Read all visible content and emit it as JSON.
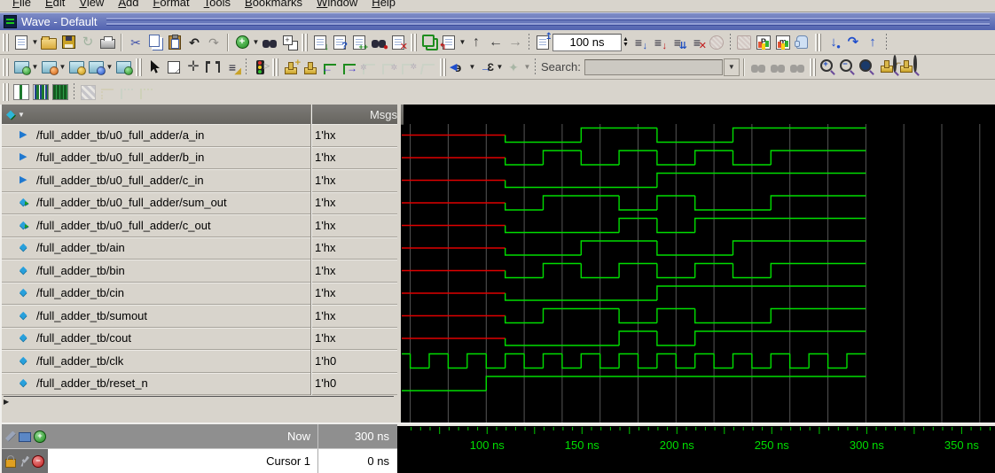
{
  "menu": {
    "items": [
      "File",
      "Edit",
      "View",
      "Add",
      "Format",
      "Tools",
      "Bookmarks",
      "Window",
      "Help"
    ]
  },
  "window": {
    "title": "Wave - Default"
  },
  "toolbar": {
    "time_value": "100 ns",
    "search_label": "Search:",
    "search_value": "",
    "row1_icons": [
      "new-doc",
      "new-doc-dropdown",
      "open-folder",
      "save",
      "refresh",
      "print",
      "cut",
      "copy",
      "paste",
      "undo",
      "redo",
      "add-circle",
      "add-dropdown",
      "find-binoculars",
      "expand-items",
      "comment-stack",
      "doc-help",
      "doc-add",
      "find-marked",
      "doc-delete",
      "link",
      "trace-list",
      "arrow-up",
      "arrow-back",
      "arrow-forward",
      "run-length-doc",
      "time-field",
      "time-spinner",
      "run",
      "run-continue",
      "run-all",
      "break-doc",
      "stop",
      "restart",
      "profile-p",
      "memory-m",
      "pause-hand",
      "step-into",
      "step-over",
      "step-out"
    ],
    "row2_icons": [
      "sim-chip-green",
      "sim-chip-orange",
      "sim-chip-gold",
      "sim-chip-save",
      "sim-chip-run",
      "select-pointer",
      "zoom-mode",
      "pan-mode",
      "cursor-pair",
      "edit-mode",
      "stop-sign-traffic",
      "stamp-add",
      "stamp",
      "edge-left",
      "edge-right",
      "wave-cut",
      "wave-copy",
      "wave-paste",
      "wave-insert",
      "prev-transition",
      "next-transition",
      "insert-marker",
      "search-input",
      "search-dropdown",
      "find-prev",
      "find-next",
      "find-all",
      "zoom-in",
      "zoom-out",
      "zoom-full",
      "zoom-cursor",
      "zoom-range"
    ],
    "row3_icons": [
      "wave-format-literal",
      "wave-format-logic",
      "wave-format-analog",
      "grid-pattern",
      "wave-pale-1",
      "wave-pale-2",
      "wave-pale-3"
    ]
  },
  "header": {
    "msgs_label": "Msgs"
  },
  "footer": {
    "now_label": "Now",
    "now_value": "300 ns",
    "cursor_label": "Cursor 1",
    "cursor_value": "0 ns"
  },
  "chart_data": {
    "type": "digital-waveform",
    "title": "ModelSim Wave - full adder testbench",
    "time_unit": "ns",
    "t_visible": [
      55.5,
      368.5
    ],
    "t_data_end": 300,
    "grid": {
      "start": 60,
      "step": 20,
      "color": "#565656"
    },
    "ruler": {
      "minor_step": 5,
      "label_step": 50,
      "labels": [
        100,
        150,
        200,
        250,
        300,
        350
      ]
    },
    "colors": {
      "signal": "#00dd00",
      "unknown": "#e00000",
      "background": "#000000"
    },
    "signals": [
      {
        "name": "/full_adder_tb/u0_full_adder/a_in",
        "value": "1'hx",
        "kind": "input",
        "wave": [
          [
            55.5,
            "x"
          ],
          [
            110,
            0
          ],
          [
            150,
            1
          ],
          [
            190,
            0
          ],
          [
            230,
            1
          ]
        ]
      },
      {
        "name": "/full_adder_tb/u0_full_adder/b_in",
        "value": "1'hx",
        "kind": "input",
        "wave": [
          [
            55.5,
            "x"
          ],
          [
            110,
            0
          ],
          [
            130,
            1
          ],
          [
            150,
            0
          ],
          [
            170,
            1
          ],
          [
            190,
            0
          ],
          [
            210,
            1
          ],
          [
            230,
            0
          ],
          [
            250,
            1
          ]
        ]
      },
      {
        "name": "/full_adder_tb/u0_full_adder/c_in",
        "value": "1'hx",
        "kind": "input",
        "wave": [
          [
            55.5,
            "x"
          ],
          [
            110,
            0
          ],
          [
            190,
            1
          ]
        ]
      },
      {
        "name": "/full_adder_tb/u0_full_adder/sum_out",
        "value": "1'hx",
        "kind": "output",
        "wave": [
          [
            55.5,
            "x"
          ],
          [
            110,
            0
          ],
          [
            130,
            1
          ],
          [
            170,
            0
          ],
          [
            190,
            1
          ],
          [
            210,
            0
          ],
          [
            250,
            1
          ]
        ]
      },
      {
        "name": "/full_adder_tb/u0_full_adder/c_out",
        "value": "1'hx",
        "kind": "output",
        "wave": [
          [
            55.5,
            "x"
          ],
          [
            110,
            0
          ],
          [
            170,
            1
          ],
          [
            190,
            0
          ],
          [
            210,
            1
          ]
        ]
      },
      {
        "name": "/full_adder_tb/ain",
        "value": "1'hx",
        "kind": "signal",
        "wave": [
          [
            55.5,
            "x"
          ],
          [
            110,
            0
          ],
          [
            150,
            1
          ],
          [
            190,
            0
          ],
          [
            230,
            1
          ]
        ]
      },
      {
        "name": "/full_adder_tb/bin",
        "value": "1'hx",
        "kind": "signal",
        "wave": [
          [
            55.5,
            "x"
          ],
          [
            110,
            0
          ],
          [
            130,
            1
          ],
          [
            150,
            0
          ],
          [
            170,
            1
          ],
          [
            190,
            0
          ],
          [
            210,
            1
          ],
          [
            230,
            0
          ],
          [
            250,
            1
          ]
        ]
      },
      {
        "name": "/full_adder_tb/cin",
        "value": "1'hx",
        "kind": "signal",
        "wave": [
          [
            55.5,
            "x"
          ],
          [
            110,
            0
          ],
          [
            190,
            1
          ]
        ]
      },
      {
        "name": "/full_adder_tb/sumout",
        "value": "1'hx",
        "kind": "signal",
        "wave": [
          [
            55.5,
            "x"
          ],
          [
            110,
            0
          ],
          [
            130,
            1
          ],
          [
            170,
            0
          ],
          [
            190,
            1
          ],
          [
            210,
            0
          ],
          [
            250,
            1
          ]
        ]
      },
      {
        "name": "/full_adder_tb/cout",
        "value": "1'hx",
        "kind": "signal",
        "wave": [
          [
            55.5,
            "x"
          ],
          [
            110,
            0
          ],
          [
            170,
            1
          ],
          [
            190,
            0
          ],
          [
            210,
            1
          ]
        ]
      },
      {
        "name": "/full_adder_tb/clk",
        "value": "1'h0",
        "kind": "signal",
        "wave": [
          [
            55.5,
            1
          ],
          [
            60,
            0
          ],
          [
            70,
            1
          ],
          [
            80,
            0
          ],
          [
            90,
            1
          ],
          [
            100,
            0
          ],
          [
            110,
            1
          ],
          [
            120,
            0
          ],
          [
            130,
            1
          ],
          [
            140,
            0
          ],
          [
            150,
            1
          ],
          [
            160,
            0
          ],
          [
            170,
            1
          ],
          [
            180,
            0
          ],
          [
            190,
            1
          ],
          [
            200,
            0
          ],
          [
            210,
            1
          ],
          [
            220,
            0
          ],
          [
            230,
            1
          ],
          [
            240,
            0
          ],
          [
            250,
            1
          ],
          [
            260,
            0
          ],
          [
            270,
            1
          ],
          [
            280,
            0
          ],
          [
            290,
            1
          ]
        ]
      },
      {
        "name": "/full_adder_tb/reset_n",
        "value": "1'h0",
        "kind": "signal",
        "wave": [
          [
            55.5,
            0
          ],
          [
            100,
            1
          ]
        ]
      }
    ]
  }
}
